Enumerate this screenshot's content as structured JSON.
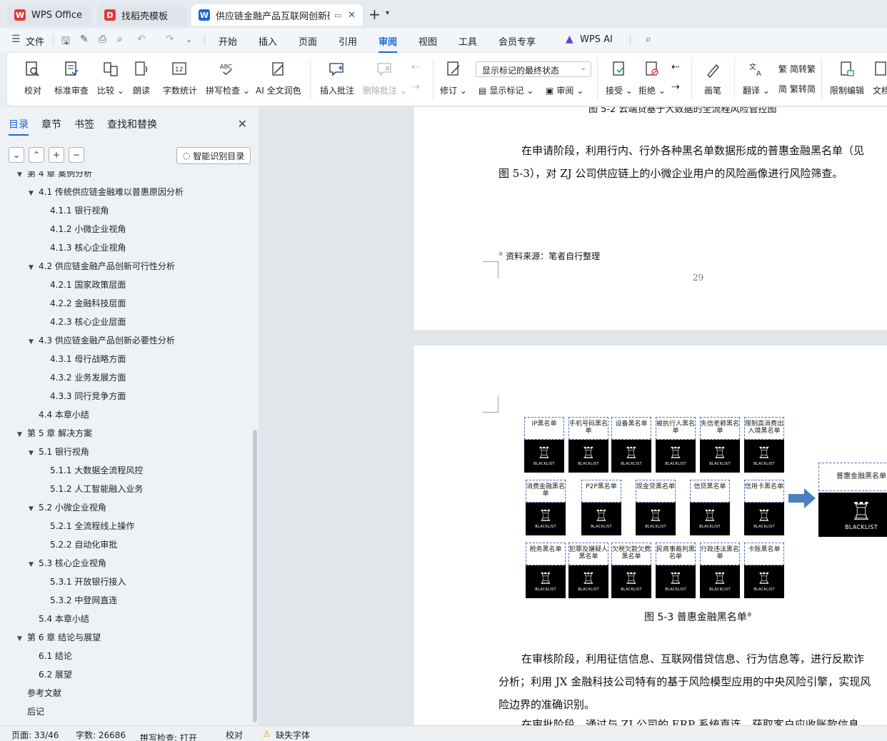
{
  "tabs": [
    {
      "label": "WPS Office",
      "icon": "wps-logo-icon",
      "color": "#e53935"
    },
    {
      "label": "找稻壳模板",
      "icon": "docer-icon",
      "color": "#e53935"
    },
    {
      "label": "供应链金融产品互联网创新研究",
      "icon": "wps-writer-icon",
      "color": "#1e64d7"
    }
  ],
  "menu": {
    "file": "文件",
    "items": [
      "开始",
      "插入",
      "页面",
      "引用",
      "审阅",
      "视图",
      "工具",
      "会员专享"
    ],
    "active": "审阅",
    "wps_ai": "WPS AI"
  },
  "ribbon": {
    "proofread": "校对",
    "std_review": "标准审查",
    "compare": "比较",
    "read_aloud": "朗读",
    "word_count": "字数统计",
    "spell_check": "拼写检查",
    "ai_polish": "AI 全文润色",
    "insert_comment": "插入批注",
    "delete_comment": "删除批注",
    "track": "修订",
    "markup_state": "显示标记的最终状态",
    "show_markup": "显示标记",
    "review": "审阅",
    "accept": "接受",
    "reject": "拒绝",
    "brush": "画笔",
    "translate": "翻译",
    "to_trad": "简转繁",
    "to_simp": "繁转简",
    "restrict": "限制编辑",
    "doc_more": "文档"
  },
  "sidebar": {
    "tabs": [
      "目录",
      "章节",
      "书签",
      "查找和替换"
    ],
    "smart": "智能识别目录",
    "toc": [
      {
        "level": 1,
        "label": "第 4 章  案例分析",
        "arrow": true
      },
      {
        "level": 2,
        "label": "4.1  传统供应链金融难以普惠原因分析",
        "arrow": true
      },
      {
        "level": 3,
        "label": "4.1.1  银行视角"
      },
      {
        "level": 3,
        "label": "4.1.2  小微企业视角"
      },
      {
        "level": 3,
        "label": "4.1.3  核心企业视角"
      },
      {
        "level": 2,
        "label": "4.2  供应链金融产品创新可行性分析",
        "arrow": true
      },
      {
        "level": 3,
        "label": "4.2.1  国家政策层面"
      },
      {
        "level": 3,
        "label": "4.2.2  金融科技层面"
      },
      {
        "level": 3,
        "label": "4.2.3  核心企业层面"
      },
      {
        "level": 2,
        "label": "4.3  供应链金融产品创新必要性分析",
        "arrow": true
      },
      {
        "level": 3,
        "label": "4.3.1  母行战略方面"
      },
      {
        "level": 3,
        "label": "4.3.2  业务发展方面"
      },
      {
        "level": 3,
        "label": "4.3.3  同行竞争方面"
      },
      {
        "level": 2,
        "label": "4.4  本章小结"
      },
      {
        "level": 1,
        "label": "第 5 章  解决方案",
        "arrow": true
      },
      {
        "level": 2,
        "label": "5.1 银行视角",
        "arrow": true
      },
      {
        "level": 3,
        "label": "5.1.1  大数据全流程风控"
      },
      {
        "level": 3,
        "label": "5.1.2  人工智能融入业务"
      },
      {
        "level": 2,
        "label": "5.2 小微企业视角",
        "arrow": true
      },
      {
        "level": 3,
        "label": "5.2.1  全流程线上操作"
      },
      {
        "level": 3,
        "label": "5.2.2  自动化审批"
      },
      {
        "level": 2,
        "label": "5.3  核心企业视角",
        "arrow": true
      },
      {
        "level": 3,
        "label": "5.3.1  开放银行接入"
      },
      {
        "level": 3,
        "label": "5.3.2  中登网直连"
      },
      {
        "level": 2,
        "label": "5.4  本章小结"
      },
      {
        "level": 1,
        "label": "第 6 章  结论与展望",
        "arrow": true
      },
      {
        "level": 2,
        "label": "6.1  结论"
      },
      {
        "level": 2,
        "label": "6.2  展望"
      },
      {
        "level": 1,
        "label": "参考文献"
      },
      {
        "level": 1,
        "label": "后记"
      }
    ]
  },
  "doc": {
    "fig52_caption": "图 5-2  云端贷基于大数据的全流程风险管控图",
    "para1_line1": "在申请阶段，利用行内、行外各种黑名单数据形成的普惠金融黑名单（见",
    "para1_line2": "图 5-3），对 ZJ 公司供应链上的小微企业用户的风险画像进行风险筛查。",
    "footnote": "资料来源：笔者自行整理",
    "footnote_mark": "⑦",
    "page_number": "29",
    "fig53_caption": "图 5-3  普惠金融黑名单",
    "fig53_mark": "⑧",
    "blacklist_text": "BLACKLIST",
    "blacklists": [
      "IP黑名单",
      "手机号码黑名单",
      "设备黑名单",
      "被执行人黑名单",
      "失信老赖黑名单",
      "限制高消费出入境黑名单",
      "消费金融黑名单",
      "P2P黑名单",
      "现金贷黑名单",
      "信贷黑名单",
      "信用卡黑名单",
      "税务黑名单",
      "犯罪及嫌疑人黑名单",
      "欠税欠款欠费黑名单",
      "民商事裁判黑名单",
      "行政违法黑名单",
      "卡账黑名单"
    ],
    "target": "普惠金融黑名单",
    "para2_line1": "在审核阶段，利用征信信息、互联网借贷信息、行为信息等，进行反欺诈",
    "para2_line2": "分析；利用 JX 金融科技公司特有的基于风险模型应用的中央风险引擎，实现风",
    "para2_line3": "险边界的准确识别。",
    "para3_line1": "在审批阶段，通过与 ZJ 公司的 ERP 系统直连，获取客户应收账款信息"
  },
  "status": {
    "page": "页面: 33/46",
    "words": "字数: 26686",
    "spell": "拼写检查: 打开",
    "proof": "校对",
    "missing_font": "缺失字体"
  },
  "colors": {
    "accent": "#1e64d7",
    "arrow": "#4a7fc1"
  }
}
